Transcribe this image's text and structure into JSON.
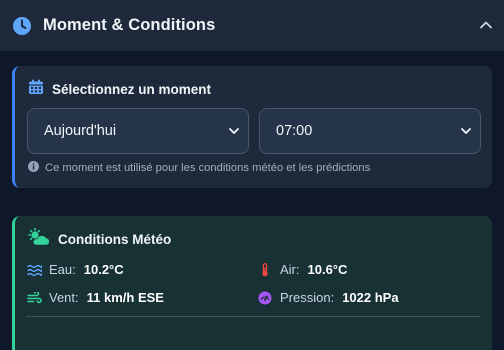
{
  "header": {
    "title": "Moment & Conditions",
    "icon": "clock-icon",
    "collapse_icon": "chevron-up-icon"
  },
  "moment": {
    "title": "Sélectionnez un moment",
    "icon": "calendar-icon",
    "day_select": {
      "value": "Aujourd'hui"
    },
    "time_select": {
      "value": "07:00"
    },
    "hint": "Ce moment est utilisé pour les conditions météo et les prédictions"
  },
  "meteo": {
    "title": "Conditions Météo",
    "icon": "cloud-sun-icon",
    "items": [
      {
        "label": "Eau:",
        "value": "10.2°C",
        "icon": "water-icon"
      },
      {
        "label": "Air:",
        "value": "10.6°C",
        "icon": "thermometer-icon"
      },
      {
        "label": "Vent:",
        "value": "11 km/h ESE",
        "icon": "wind-icon"
      },
      {
        "label": "Pression:",
        "value": "1022 hPa",
        "icon": "gauge-icon"
      }
    ]
  },
  "colors": {
    "accent_blue": "#3b82f6",
    "accent_green": "#34d399",
    "thermo_red": "#ef4444",
    "gauge_purple": "#a855f7"
  }
}
